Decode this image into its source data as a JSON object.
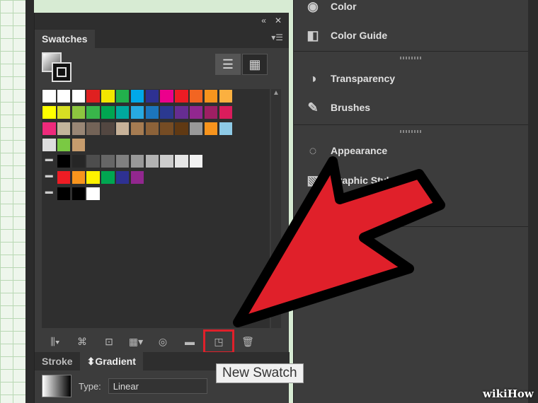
{
  "swatches_panel": {
    "tab_label": "Swatches",
    "list_view_icon": "list-view-icon",
    "grid_view_icon": "grid-view-icon",
    "rows": [
      [
        "#ffffff",
        "#ffffff",
        "#ffffff",
        "#e02020",
        "#f2e600",
        "#22b14c",
        "#00a8e8",
        "#2e3192",
        "#ec008c",
        "#ed1c24",
        "#f26522",
        "#f7941d",
        "#fbb040"
      ],
      [
        "#ffff00",
        "#d7df23",
        "#8dc63f",
        "#39b54a",
        "#00a651",
        "#00a99d",
        "#27aae1",
        "#1c75bc",
        "#2b3990",
        "#662d91",
        "#92278f",
        "#9e1f63",
        "#da1c5c"
      ],
      [
        "#ee2a7b",
        "#c2b59b",
        "#998675",
        "#736357",
        "#534741",
        "#c7b299",
        "#a67c52",
        "#8c6239",
        "#754c24",
        "#603913",
        "#999999",
        "#f7941d",
        "#8ecae6"
      ],
      [
        "#dddddd",
        "#7ac943",
        "#c69c6d"
      ],
      [
        "#555555",
        "#000000",
        "#262626",
        "#4d4d4d",
        "#666666",
        "#808080",
        "#999999",
        "#b3b3b3",
        "#cccccc",
        "#e6e6e6",
        "#f2f2f2"
      ],
      [
        "#555555",
        "#ed1c24",
        "#f7941d",
        "#fff200",
        "#00a651",
        "#2e3192",
        "#92278f"
      ],
      [
        "#555555",
        "#000000",
        "#000000",
        "#ffffff"
      ]
    ]
  },
  "bottom": {
    "stroke_tab": "Stroke",
    "gradient_tab": "Gradient",
    "type_label": "Type:",
    "type_value": "Linear"
  },
  "right_panel": {
    "color_label": "Color",
    "color_guide_label": "Color Guide",
    "transparency_label": "Transparency",
    "brushes_label": "Brushes",
    "appearance_label": "Appearance",
    "graphic_styles_label": "Graphic Styles"
  },
  "tooltip": "New Swatch",
  "watermark": "wikiHow",
  "colors": {
    "arrow": "#e0202a",
    "highlight": "#e0202a"
  }
}
